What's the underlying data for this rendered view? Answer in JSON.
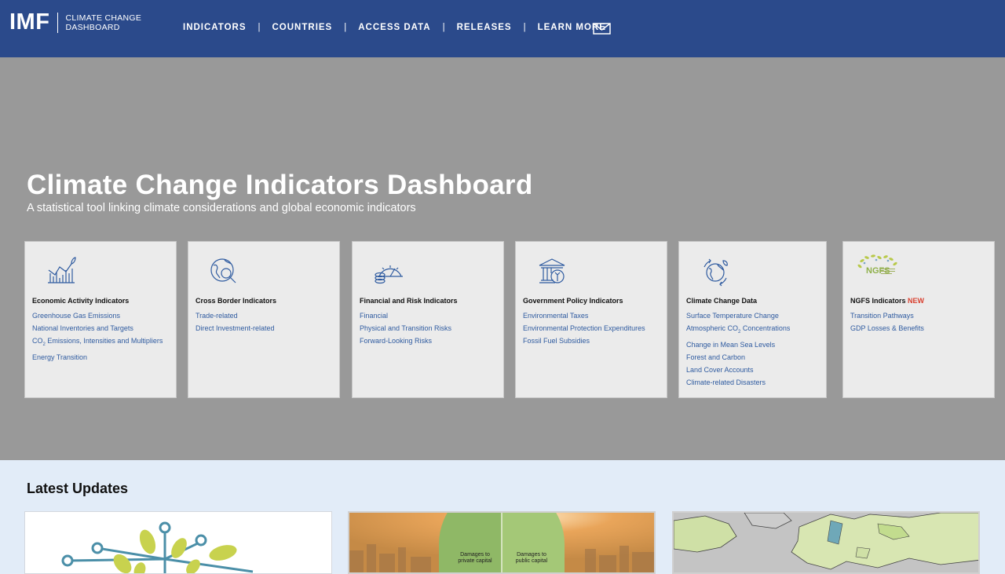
{
  "header": {
    "logo_mark": "IMF",
    "logo_line1": "CLIMATE CHANGE",
    "logo_line2": "DASHBOARD",
    "nav": [
      "INDICATORS",
      "COUNTRIES",
      "ACCESS DATA",
      "RELEASES",
      "LEARN MORE"
    ],
    "nav_separator": "|",
    "mail_icon": "envelope-icon"
  },
  "hero": {
    "title": "Climate Change Indicators Dashboard",
    "subtitle": "A statistical tool linking climate considerations and global economic indicators"
  },
  "cards": [
    {
      "icon": "bar-chart-plant-icon",
      "title": "Economic Activity Indicators",
      "links": [
        "Greenhouse Gas Emissions",
        "National Inventories and Targets",
        "CO2 Emissions, Intensities and Multipliers",
        "Energy Transition"
      ]
    },
    {
      "icon": "globe-magnifier-icon",
      "title": "Cross Border Indicators",
      "links": [
        "Trade-related",
        "Direct Investment-related"
      ]
    },
    {
      "icon": "gauge-coins-icon",
      "title": "Financial and Risk Indicators",
      "links": [
        "Financial",
        "Physical and Transition Risks",
        "Forward-Looking Risks"
      ]
    },
    {
      "icon": "government-building-icon",
      "title": "Government Policy Indicators",
      "links": [
        "Environmental Taxes",
        "Environmental Protection Expenditures",
        "Fossil Fuel Subsidies"
      ]
    },
    {
      "icon": "globe-cycle-icon",
      "title": "Climate Change Data",
      "links": [
        "Surface Temperature Change",
        "Atmospheric CO2 Concentrations",
        "Change in Mean Sea Levels",
        "Forest and Carbon",
        "Land Cover Accounts",
        "Climate-related Disasters"
      ]
    },
    {
      "icon": "ngfs-logo-icon",
      "title": "NGFS Indicators",
      "badge": "NEW",
      "logo_text": "NGFS",
      "links": [
        "Transition Pathways",
        "GDP Losses & Benefits"
      ]
    }
  ],
  "updates": {
    "title": "Latest Updates",
    "thumb2_label_left": "Damages to private capital",
    "thumb2_label_right": "Damages to public capital"
  },
  "colors": {
    "header_bg": "#2b4a8b",
    "hero_bg": "#999999",
    "card_bg": "#ebebeb",
    "link": "#2f5ba0",
    "new_badge": "#d9402f",
    "updates_bg": "#e2ecf8"
  }
}
